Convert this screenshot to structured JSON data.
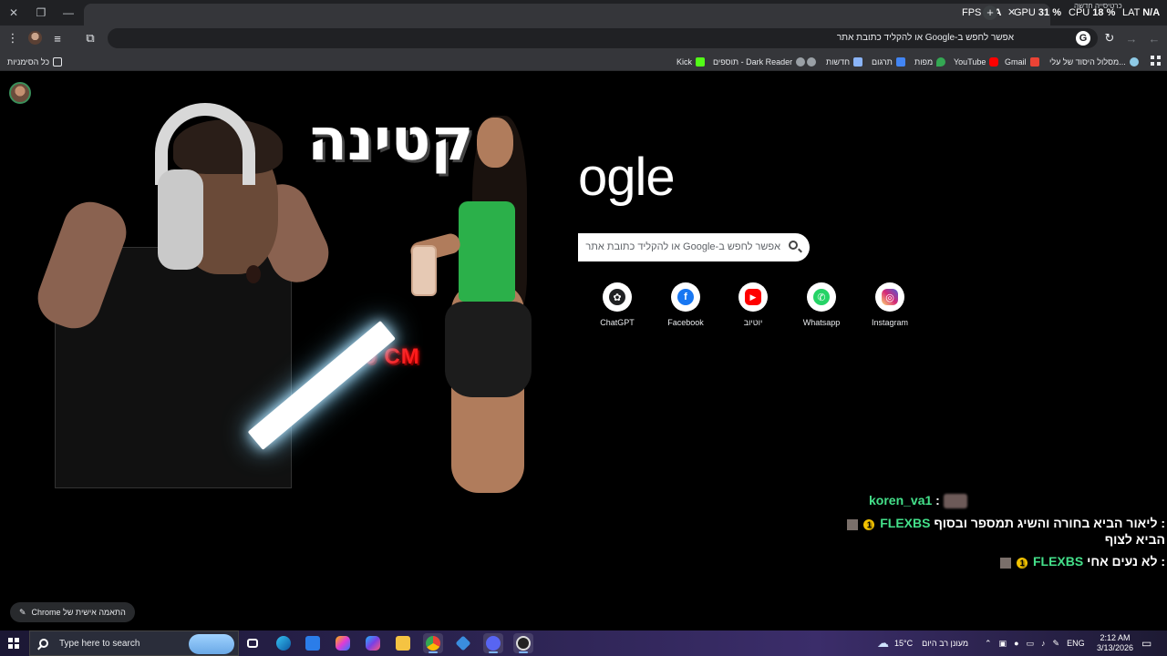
{
  "overlay": {
    "fps_label": "FPS",
    "fps_value": "N/A",
    "gpu_label": "GPU",
    "gpu_value": "31 %",
    "cpu_label": "CPU",
    "cpu_value": "18 %",
    "lat_label": "LAT",
    "lat_value": "N/A"
  },
  "tab": {
    "title": "כרטיסייה חדשה"
  },
  "omnibox": {
    "text": "אפשר לחפש ב-Google או להקליד כתובת אתר"
  },
  "bookmarks": {
    "all_label": "כל הסימניות",
    "items": [
      {
        "label": "מסלול היסוד של עלי...",
        "color": "#8ecae6"
      },
      {
        "label": "Gmail",
        "color": "#ea4335"
      },
      {
        "label": "YouTube",
        "color": "#ff0000"
      },
      {
        "label": "מפות",
        "color": "#34a853"
      },
      {
        "label": "תרגום",
        "color": "#4285f4"
      },
      {
        "label": "חדשות",
        "color": "#8ab4f8"
      },
      {
        "label": "",
        "color": "#9aa0a6"
      },
      {
        "label": "תוספים - Dark Reader",
        "color": "#9aa0a6"
      },
      {
        "label": "Kick",
        "color": "#53fc18"
      }
    ]
  },
  "thumbnail": {
    "title": "קטינה",
    "tag": "29 CM"
  },
  "google": {
    "logo_text": "ogle",
    "search_placeholder": "אפשר לחפש ב-Google או להקליד כתובת אתר",
    "shortcuts": [
      {
        "label": "ChatGPT",
        "icon": "chatgpt-icon",
        "color": "#202123",
        "glyph": "✿"
      },
      {
        "label": "Facebook",
        "icon": "facebook-icon",
        "color": "#1877f2",
        "glyph": "f"
      },
      {
        "label": "יוטיוב",
        "icon": "youtube-icon",
        "color": "#ff0000",
        "glyph": "▶"
      },
      {
        "label": "Whatsapp",
        "icon": "whatsapp-icon",
        "color": "#25d366",
        "glyph": "✆"
      },
      {
        "label": "Instagram",
        "icon": "instagram-icon",
        "color": "#d62976",
        "glyph": "◎"
      }
    ]
  },
  "chat": {
    "line1_user": "koren_va1",
    "line1_sep": ":",
    "line2_user": "FLEXBS",
    "line2_msg_a": ": ליאור הביא בחורה והשיג תמספר ובסוף",
    "line2_msg_b": "הביא לצוף",
    "line3_user": "FLEXBS",
    "line3_msg": ": לא נעים אחי",
    "badge": "1"
  },
  "customize": {
    "label": "התאמה אישית של Chrome"
  },
  "taskbar": {
    "search_placeholder": "Type here to search",
    "weather": "15°C",
    "weather_desc": "מעונן רב היום",
    "lang": "ENG",
    "time": "2:12 AM",
    "date": "3/13/2026"
  }
}
